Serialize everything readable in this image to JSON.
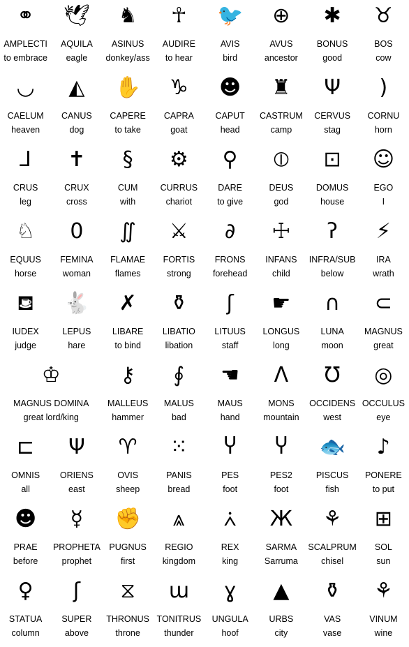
{
  "rows": [
    [
      {
        "latin": "AMPLECTI",
        "meaning": "to embrace",
        "glyph": "⚭",
        "icon": "embracing-figures-icon"
      },
      {
        "latin": "AQUILA",
        "meaning": "eagle",
        "glyph": "🕊",
        "icon": "eagle-icon"
      },
      {
        "latin": "ASINUS",
        "meaning": "donkey/ass",
        "glyph": "♞",
        "icon": "donkey-head-icon"
      },
      {
        "latin": "AUDIRE",
        "meaning": "to hear",
        "glyph": "☥",
        "icon": "listening-figure-icon"
      },
      {
        "latin": "AVIS",
        "meaning": "bird",
        "glyph": "🐦",
        "icon": "bird-icon"
      },
      {
        "latin": "AVUS",
        "meaning": "ancestor",
        "glyph": "⊕",
        "icon": "ancestor-icon"
      },
      {
        "latin": "BONUS",
        "meaning": "good",
        "glyph": "✱",
        "icon": "good-sign-icon"
      },
      {
        "latin": "BOS",
        "meaning": "cow",
        "glyph": "♉",
        "icon": "cow-head-icon"
      }
    ],
    [
      {
        "latin": "CAELUM",
        "meaning": "heaven",
        "glyph": "◡",
        "icon": "heaven-bowl-icon"
      },
      {
        "latin": "CANUS",
        "meaning": "dog",
        "glyph": "◭",
        "icon": "dog-head-icon"
      },
      {
        "latin": "CAPERE",
        "meaning": "to take",
        "glyph": "✋",
        "icon": "taking-hands-icon"
      },
      {
        "latin": "CAPRA",
        "meaning": "goat",
        "glyph": "♑",
        "icon": "goat-head-icon"
      },
      {
        "latin": "CAPUT",
        "meaning": "head",
        "glyph": "☻",
        "icon": "head-icon"
      },
      {
        "latin": "CASTRUM",
        "meaning": "camp",
        "glyph": "♜",
        "icon": "camp-icon"
      },
      {
        "latin": "CERVUS",
        "meaning": "stag",
        "glyph": "Ψ",
        "icon": "stag-head-icon"
      },
      {
        "latin": "CORNU",
        "meaning": "horn",
        "glyph": ")",
        "icon": "horn-icon"
      }
    ],
    [
      {
        "latin": "CRUS",
        "meaning": "leg",
        "glyph": "⅃",
        "icon": "leg-icon"
      },
      {
        "latin": "CRUX",
        "meaning": "cross",
        "glyph": "✝",
        "icon": "cross-icon"
      },
      {
        "latin": "CUM",
        "meaning": "with",
        "glyph": "§",
        "icon": "with-sign-icon"
      },
      {
        "latin": "CURRUS",
        "meaning": "chariot",
        "glyph": "⚙",
        "icon": "chariot-icon"
      },
      {
        "latin": "DARE",
        "meaning": "to give",
        "glyph": "⚲",
        "icon": "giving-hand-icon"
      },
      {
        "latin": "DEUS",
        "meaning": "god",
        "glyph": "⦶",
        "icon": "god-icon"
      },
      {
        "latin": "DOMUS",
        "meaning": "house",
        "glyph": "⊡",
        "icon": "house-icon"
      },
      {
        "latin": "EGO",
        "meaning": "I",
        "glyph": "☺",
        "icon": "self-figure-icon"
      }
    ],
    [
      {
        "latin": "EQUUS",
        "meaning": "horse",
        "glyph": "♘",
        "icon": "horse-head-icon"
      },
      {
        "latin": "FEMINA",
        "meaning": "woman",
        "glyph": "0",
        "icon": "woman-oval-icon"
      },
      {
        "latin": "FLAMAE",
        "meaning": "flames",
        "glyph": "∬",
        "icon": "flames-icon"
      },
      {
        "latin": "FORTIS",
        "meaning": "strong",
        "glyph": "⚔",
        "icon": "strong-arm-icon"
      },
      {
        "latin": "FRONS",
        "meaning": "forehead",
        "glyph": "∂",
        "icon": "forehead-icon"
      },
      {
        "latin": "INFANS",
        "meaning": "child",
        "glyph": "☩",
        "icon": "child-icon"
      },
      {
        "latin": "INFRA/SUB",
        "meaning": "below",
        "glyph": "ʔ",
        "icon": "below-sign-icon"
      },
      {
        "latin": "IRA",
        "meaning": "wrath",
        "glyph": "⚡",
        "icon": "wrath-faces-icon"
      }
    ],
    [
      {
        "latin": "IUDEX",
        "meaning": "judge",
        "glyph": "⛾",
        "icon": "judge-icon"
      },
      {
        "latin": "LEPUS",
        "meaning": "hare",
        "glyph": "🐇",
        "icon": "hare-icon"
      },
      {
        "latin": "LIBARE",
        "meaning": "to bind",
        "glyph": "✗",
        "icon": "binding-hands-icon"
      },
      {
        "latin": "LIBATIO",
        "meaning": "libation",
        "glyph": "⚱",
        "icon": "libation-icon"
      },
      {
        "latin": "LITUUS",
        "meaning": "staff",
        "glyph": "ʃ",
        "icon": "staff-icon"
      },
      {
        "latin": "LONGUS",
        "meaning": "long",
        "glyph": "☛",
        "icon": "long-hand-icon"
      },
      {
        "latin": "LUNA",
        "meaning": "moon",
        "glyph": "∩",
        "icon": "moon-icon"
      },
      {
        "latin": "MAGNUS",
        "meaning": "great",
        "glyph": "⊂",
        "icon": "great-sign-icon"
      }
    ],
    [
      {
        "latin": "MAGNUS DOMINA",
        "meaning": "great lord/king",
        "glyph": "♔",
        "icon": "great-lord-icon"
      },
      {
        "latin": "MALLEUS",
        "meaning": "hammer",
        "glyph": "⚷",
        "icon": "hammer-icon"
      },
      {
        "latin": "MALUS",
        "meaning": "bad",
        "glyph": "∮",
        "icon": "bad-sign-icon"
      },
      {
        "latin": "MAUS",
        "meaning": "hand",
        "glyph": "☚",
        "icon": "hand-icon"
      },
      {
        "latin": "MONS",
        "meaning": "mountain",
        "glyph": "Λ",
        "icon": "mountain-icon"
      },
      {
        "latin": "OCCIDENS",
        "meaning": "west",
        "glyph": "Ʊ",
        "icon": "west-sign-icon"
      },
      {
        "latin": "OCCULUS",
        "meaning": "eye",
        "glyph": "◎",
        "icon": "eye-icon"
      }
    ],
    [
      {
        "latin": "OMNIS",
        "meaning": "all",
        "glyph": "⊏",
        "icon": "all-sign-icon"
      },
      {
        "latin": "ORIENS",
        "meaning": "east",
        "glyph": "Ψ",
        "icon": "east-sign-icon"
      },
      {
        "latin": "OVIS",
        "meaning": "sheep",
        "glyph": "♈",
        "icon": "sheep-head-icon"
      },
      {
        "latin": "PANIS",
        "meaning": "bread",
        "glyph": "⁙",
        "icon": "bread-icon"
      },
      {
        "latin": "PES",
        "meaning": "foot",
        "glyph": "Ⴤ",
        "icon": "foot-icon"
      },
      {
        "latin": "PES2",
        "meaning": "foot",
        "glyph": "Ⴤ",
        "icon": "foot-alt-icon"
      },
      {
        "latin": "PISCUS",
        "meaning": "fish",
        "glyph": "🐟",
        "icon": "fish-icon"
      },
      {
        "latin": "PONERE",
        "meaning": "to put",
        "glyph": "♪",
        "icon": "putting-hand-icon"
      }
    ],
    [
      {
        "latin": "PRAE",
        "meaning": "before",
        "glyph": "☻",
        "icon": "before-head-icon"
      },
      {
        "latin": "PROPHETA",
        "meaning": "prophet",
        "glyph": "☿",
        "icon": "prophet-icon"
      },
      {
        "latin": "PUGNUS",
        "meaning": "first",
        "glyph": "✊",
        "icon": "fist-icon"
      },
      {
        "latin": "REGIO",
        "meaning": "kingdom",
        "glyph": "⩓",
        "icon": "kingdom-icon"
      },
      {
        "latin": "REX",
        "meaning": "king",
        "glyph": "⩑",
        "icon": "king-icon"
      },
      {
        "latin": "SARMA",
        "meaning": "Sarruma",
        "glyph": "Ж",
        "icon": "sarruma-icon"
      },
      {
        "latin": "SCALPRUM",
        "meaning": "chisel",
        "glyph": "⚘",
        "icon": "chisel-icon"
      },
      {
        "latin": "SOL",
        "meaning": "sun",
        "glyph": "⊞",
        "icon": "sun-icon"
      }
    ],
    [
      {
        "latin": "STATUA",
        "meaning": "column",
        "glyph": "♀",
        "icon": "column-figure-icon"
      },
      {
        "latin": "SUPER",
        "meaning": "above",
        "glyph": "ʃ",
        "icon": "above-sign-icon"
      },
      {
        "latin": "THRONUS",
        "meaning": "throne",
        "glyph": "⧖",
        "icon": "throne-icon"
      },
      {
        "latin": "TONITRUS",
        "meaning": "thunder",
        "glyph": "ɯ",
        "icon": "thunder-icon"
      },
      {
        "latin": "UNGULA",
        "meaning": "hoof",
        "glyph": "ɣ",
        "icon": "hoof-icon"
      },
      {
        "latin": "URBS",
        "meaning": "city",
        "glyph": "▲",
        "icon": "city-icon"
      },
      {
        "latin": "VAS",
        "meaning": "vase",
        "glyph": "⚱",
        "icon": "vase-icon"
      },
      {
        "latin": "VINUM",
        "meaning": "wine",
        "glyph": "⚘",
        "icon": "wine-icon"
      }
    ]
  ]
}
